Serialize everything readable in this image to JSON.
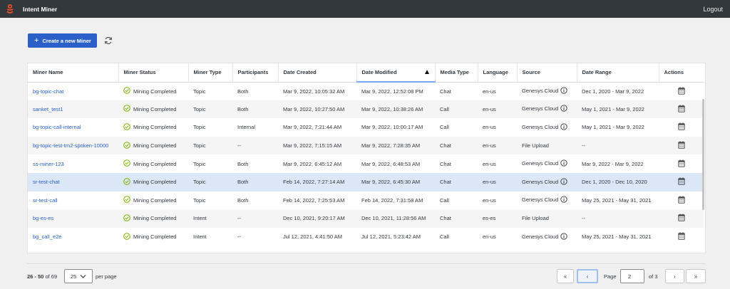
{
  "app": {
    "title": "Intent Miner",
    "logout_label": "Logout"
  },
  "toolbar": {
    "create_label": "Create a new Miner"
  },
  "table": {
    "columns": [
      "Miner Name",
      "Miner Status",
      "Miner Type",
      "Participants",
      "Date Created",
      "Date Modified",
      "Media Type",
      "Language",
      "Source",
      "Date Range",
      "Actions"
    ],
    "sorted_column": "Date Modified",
    "rows": [
      {
        "name": "bg-topic-chat",
        "status": "Mining Completed",
        "type": "Topic",
        "participants": "Both",
        "created": "Mar 9, 2022, 10:05:32 AM",
        "modified": "Mar 9, 2022, 12:52:08 PM",
        "media": "Chat",
        "language": "en-us",
        "source": "Genesys Cloud",
        "source_info": true,
        "range": "Dec 1, 2020 - Mar 9, 2022"
      },
      {
        "name": "sanket_test1",
        "status": "Mining Completed",
        "type": "Topic",
        "participants": "Both",
        "created": "Mar 9, 2022, 10:27:50 AM",
        "modified": "Mar 9, 2022, 10:38:26 AM",
        "media": "Call",
        "language": "en-us",
        "source": "Genesys Cloud",
        "source_info": true,
        "range": "May 1, 2021 - Mar 9, 2022"
      },
      {
        "name": "bg-topic-call-internal",
        "status": "Mining Completed",
        "type": "Topic",
        "participants": "Internal",
        "created": "Mar 9, 2022, 7:21:44 AM",
        "modified": "Mar 9, 2022, 10:00:17 AM",
        "media": "Call",
        "language": "en-us",
        "source": "Genesys Cloud",
        "source_info": true,
        "range": "May 1, 2021 - Mar 9, 2022"
      },
      {
        "name": "bg-topic-test-tm2-spoken-10000",
        "status": "Mining Completed",
        "type": "Topic",
        "participants": "--",
        "created": "Mar 9, 2022, 7:15:15 AM",
        "modified": "Mar 9, 2022, 7:28:35 AM",
        "media": "Chat",
        "language": "en-us",
        "source": "File Upload",
        "source_info": false,
        "range": "--"
      },
      {
        "name": "ss-miner-123",
        "status": "Mining Completed",
        "type": "Topic",
        "participants": "Both",
        "created": "Mar 9, 2022, 6:45:12 AM",
        "modified": "Mar 9, 2022, 6:48:53 AM",
        "media": "Chat",
        "language": "en-us",
        "source": "Genesys Cloud",
        "source_info": true,
        "range": "Mar 9, 2022 - Mar 9, 2022"
      },
      {
        "name": "sr-test-chat",
        "status": "Mining Completed",
        "type": "Topic",
        "participants": "Both",
        "created": "Feb 14, 2022, 7:27:14 AM",
        "modified": "Mar 9, 2022, 6:45:30 AM",
        "media": "Chat",
        "language": "en-us",
        "source": "Genesys Cloud",
        "source_info": true,
        "range": "Dec 1, 2020 - Dec 10, 2020"
      },
      {
        "name": "sr-test-call",
        "status": "Mining Completed",
        "type": "Topic",
        "participants": "Both",
        "created": "Feb 14, 2022, 7:25:53 AM",
        "modified": "Feb 14, 2022, 7:31:58 AM",
        "media": "Call",
        "language": "en-us",
        "source": "Genesys Cloud",
        "source_info": true,
        "range": "May 25, 2021 - May 31, 2021"
      },
      {
        "name": "bg-es-es",
        "status": "Mining Completed",
        "type": "Intent",
        "participants": "--",
        "created": "Dec 10, 2021, 9:20:17 AM",
        "modified": "Dec 10, 2021, 11:28:56 AM",
        "media": "Chat",
        "language": "es-es",
        "source": "File Upload",
        "source_info": false,
        "range": "--"
      },
      {
        "name": "bg_call_e2e",
        "status": "Mining Completed",
        "type": "Intent",
        "participants": "--",
        "created": "Jul 12, 2021, 4:41:50 AM",
        "modified": "Jul 12, 2021, 5:23:42 AM",
        "media": "Call",
        "language": "en-us",
        "source": "Genesys Cloud",
        "source_info": true,
        "range": "May 25, 2021 - May 31, 2021"
      }
    ],
    "selected_row": 5
  },
  "pagination": {
    "range_bold": "26 - 50",
    "range_rest": " of 69",
    "page_size": "25",
    "per_page_label": "per page",
    "first": "«",
    "prev": "‹",
    "next": "›",
    "last": "»",
    "page_label": "Page",
    "current_page": "2",
    "of_pages": "of 3"
  },
  "colors": {
    "topbar": "#33383d",
    "accent": "#2a60c8",
    "success": "#77b300",
    "selected": "#dbe6f7"
  }
}
